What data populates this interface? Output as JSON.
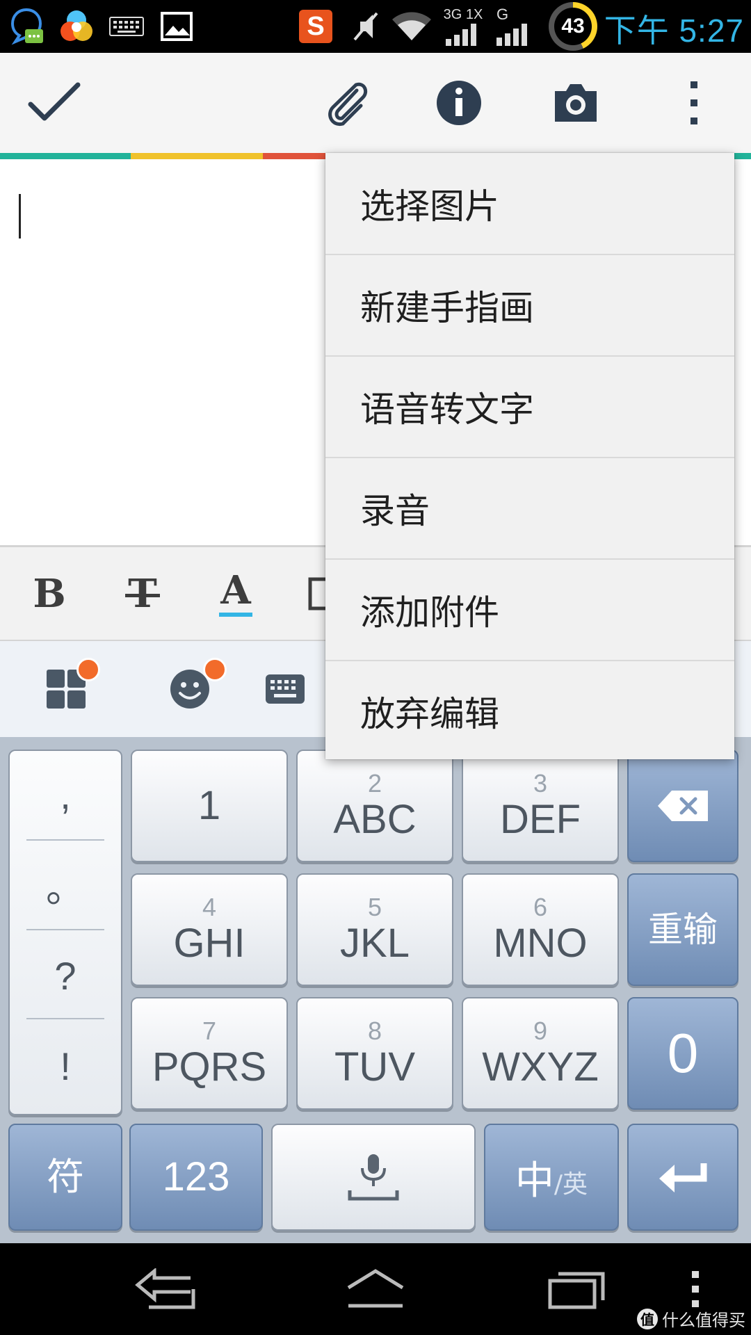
{
  "status_bar": {
    "time": "下午 5:27",
    "battery_level": "43",
    "network_label_top": "3G 1X",
    "signal_label": "G",
    "ime_app_icon_text": "S",
    "icons": [
      "chat-notification-icon",
      "color-app-icon",
      "keyboard-icon",
      "image-icon",
      "sogou-icon",
      "mute-icon",
      "wifi-icon",
      "signal-3g-icon",
      "signal-g-icon",
      "battery-icon"
    ]
  },
  "action_bar": {
    "icons": [
      "checkmark-icon",
      "paperclip-icon",
      "info-icon",
      "camera-icon",
      "overflow-icon"
    ],
    "accent": "#2e3e51"
  },
  "stripe_colors": [
    "#22b39a",
    "#f0c22b",
    "#e0533b",
    "#22b39a"
  ],
  "format_toolbar": {
    "bold": "B",
    "strikethrough": "T",
    "text_color": "A",
    "text_color_underline": "#33b5e5"
  },
  "ime_bar": {
    "icons": [
      "apps-grid-icon",
      "emoji-icon",
      "keyboard-switch-icon"
    ],
    "badge_color": "#f26b2a"
  },
  "keyboard": {
    "punctuation": [
      ",",
      "。",
      "?",
      "!"
    ],
    "rows": [
      [
        {
          "num": "",
          "label": "1"
        },
        {
          "num": "2",
          "label": "ABC"
        },
        {
          "num": "3",
          "label": "DEF"
        }
      ],
      [
        {
          "num": "4",
          "label": "GHI"
        },
        {
          "num": "5",
          "label": "JKL"
        },
        {
          "num": "6",
          "label": "MNO"
        }
      ],
      [
        {
          "num": "7",
          "label": "PQRS"
        },
        {
          "num": "8",
          "label": "TUV"
        },
        {
          "num": "9",
          "label": "WXYZ"
        }
      ]
    ],
    "side_keys": {
      "delete_icon": "backspace-icon",
      "reinput": "重输",
      "zero": "0"
    },
    "bottom_row": {
      "symbols": "符",
      "numbers": "123",
      "voice_icon": "microphone-icon",
      "lang_zh": "中",
      "lang_en": "/英",
      "enter_icon": "enter-icon"
    }
  },
  "overflow_menu": {
    "items": [
      "选择图片",
      "新建手指画",
      "语音转文字",
      "录音",
      "添加附件",
      "放弃编辑"
    ]
  },
  "nav_bar": {
    "icons": [
      "back-icon",
      "home-icon",
      "recent-apps-icon",
      "menu-dots-icon"
    ]
  },
  "watermark": {
    "logo_text": "值",
    "text": "什么值得买"
  }
}
